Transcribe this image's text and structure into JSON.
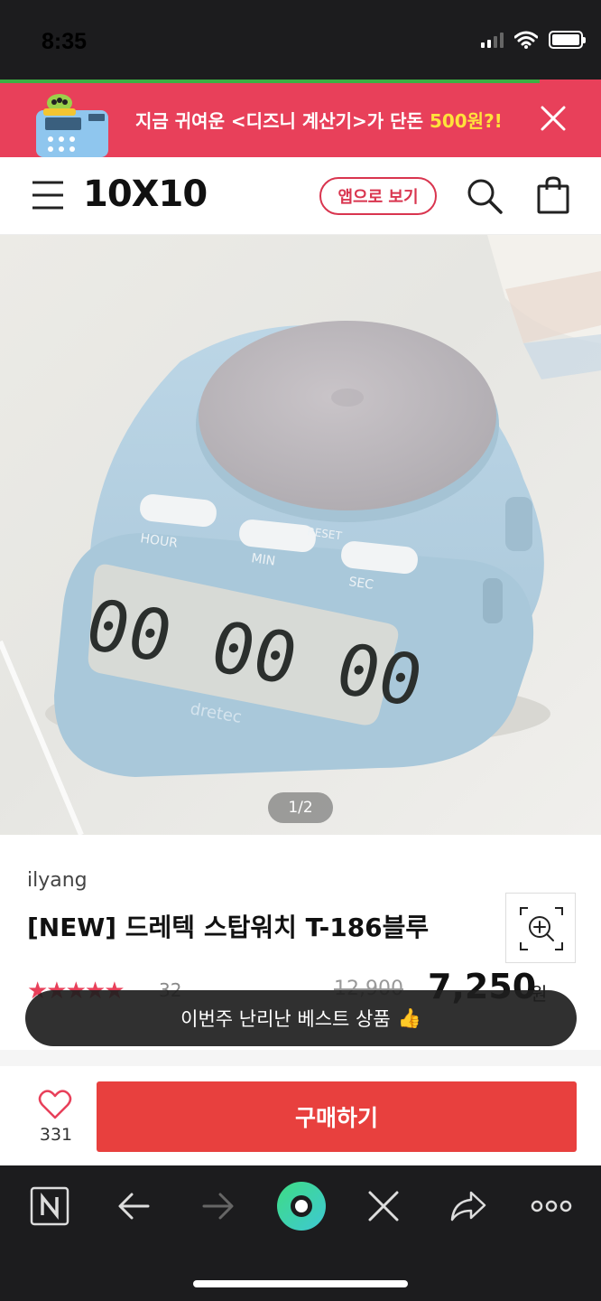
{
  "status_bar": {
    "time": "8:35"
  },
  "promo": {
    "text": "지금 귀여운 <디즈니 계산기>가 단돈 ",
    "highlight": "500원?!",
    "close_icon": "close-icon"
  },
  "header": {
    "menu_icon": "hamburger-menu-icon",
    "logo": "10X10",
    "app_button": "앱으로 보기",
    "search_icon": "search-icon",
    "cart_icon": "shopping-bag-icon"
  },
  "product": {
    "image_counter": "1/2",
    "brand": "ilyang",
    "title": "[NEW] 드레텍 스탑워치 T-186블루",
    "rating_stars": "★★★★★",
    "review_count": "32",
    "original_price": "12,900",
    "sale_price": "7,250",
    "currency": "원"
  },
  "toast": {
    "text": "이번주 난리난 베스트 상품",
    "emoji": "👍"
  },
  "purchase": {
    "like_count": "331",
    "buy_label": "구매하기"
  },
  "colors": {
    "accent": "#e8405a",
    "buy": "#e8403e",
    "browser_bar": "#1c1c1e"
  }
}
